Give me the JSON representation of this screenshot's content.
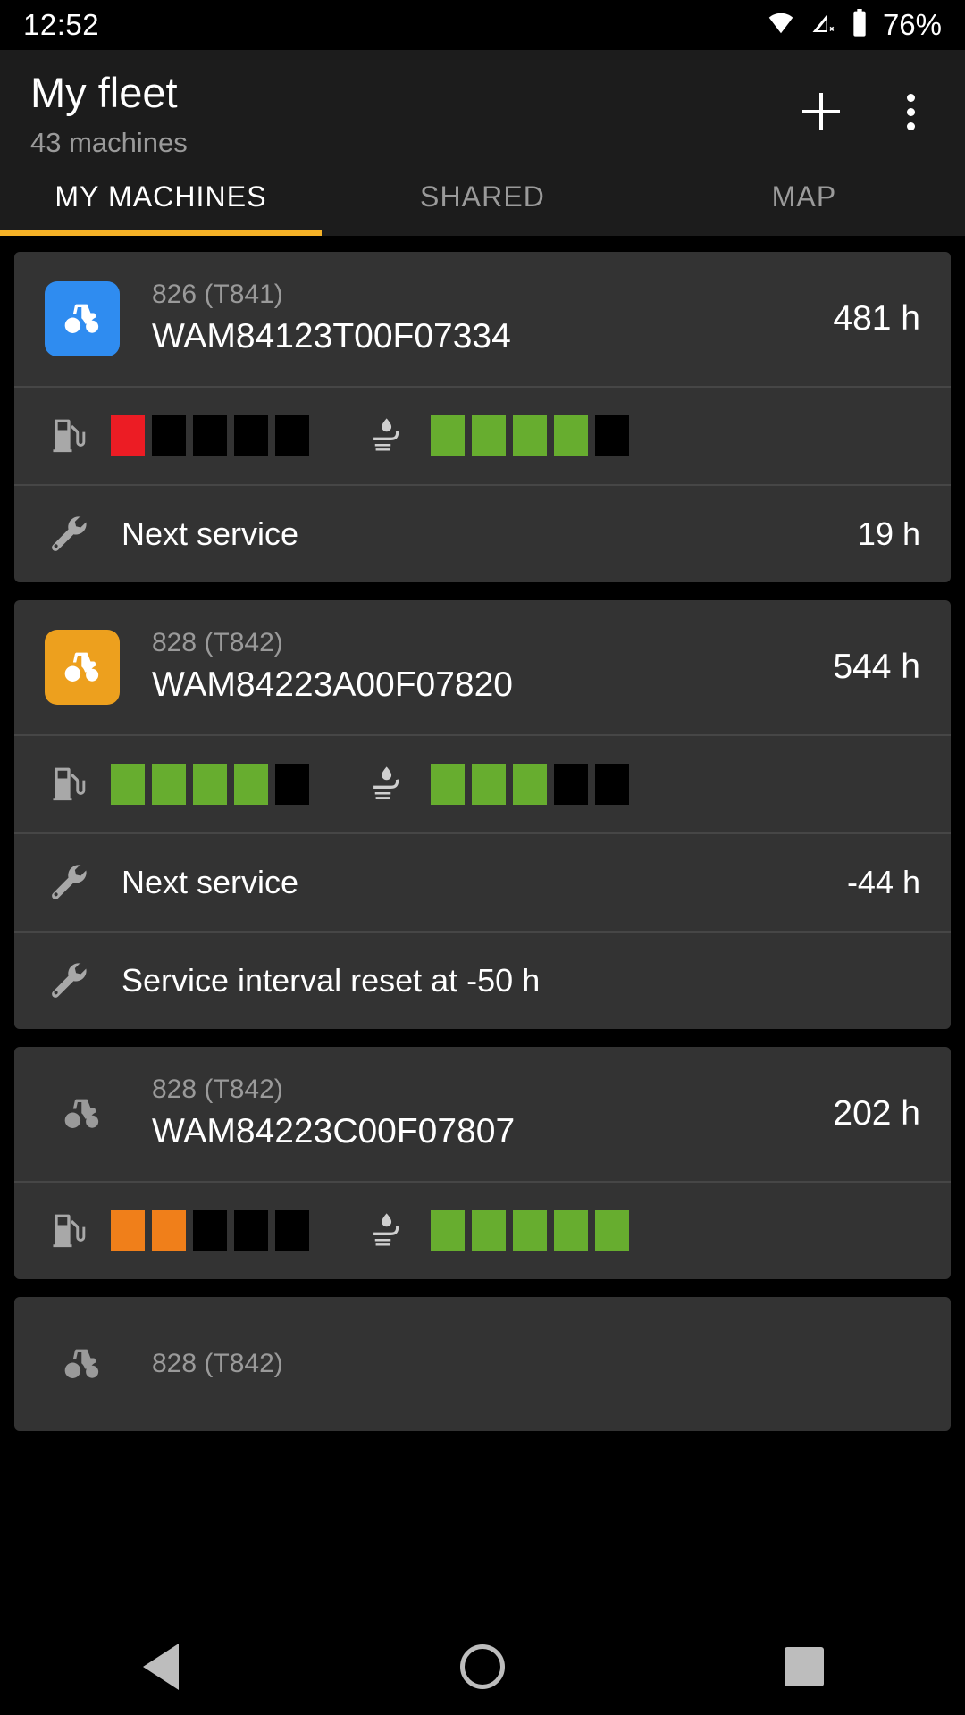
{
  "statusbar": {
    "time": "12:52",
    "battery_percent": "76%",
    "icons": [
      "wifi-icon",
      "cellular-off-icon",
      "battery-icon"
    ]
  },
  "appbar": {
    "title": "My fleet",
    "subtitle": "43 machines",
    "add_label": "+",
    "menu_label": "⋮"
  },
  "tabs": {
    "items": [
      {
        "label": "MY MACHINES",
        "active": true
      },
      {
        "label": "SHARED",
        "active": false
      },
      {
        "label": "MAP",
        "active": false
      }
    ],
    "indicator_color": "#f5b227"
  },
  "colors": {
    "accent": "#f5b227",
    "card_bg": "#333333",
    "page_bg": "#000000",
    "appbar_bg": "#1c1c1c",
    "bar_green": "#67ad2f",
    "bar_red": "#ec1c24",
    "bar_orange": "#f07f1a",
    "bar_empty": "#000000",
    "icon_blue": "#2f8cf0",
    "icon_orange": "#eda01e",
    "icon_grey": "#9a9a9a",
    "text_primary": "#ffffff",
    "text_secondary": "#9a9a9a"
  },
  "machines": [
    {
      "icon": "tractor-icon",
      "icon_color": "#2f8cf0",
      "icon_style": "filled",
      "model": "826 (T841)",
      "serial": "WAM84123T00F07334",
      "hours": "481 h",
      "fuel": {
        "icon": "fuel-pump-icon",
        "segments": [
          "red",
          "empty",
          "empty",
          "empty",
          "empty"
        ]
      },
      "def": {
        "icon": "def-fluid-icon",
        "segments": [
          "green",
          "green",
          "green",
          "green",
          "empty"
        ]
      },
      "rows": [
        {
          "icon": "wrench-icon",
          "label": "Next service",
          "value": "19 h"
        }
      ]
    },
    {
      "icon": "tractor-icon",
      "icon_color": "#eda01e",
      "icon_style": "filled",
      "model": "828 (T842)",
      "serial": "WAM84223A00F07820",
      "hours": "544 h",
      "fuel": {
        "icon": "fuel-pump-icon",
        "segments": [
          "green",
          "green",
          "green",
          "green",
          "empty"
        ]
      },
      "def": {
        "icon": "def-fluid-icon",
        "segments": [
          "green",
          "green",
          "green",
          "empty",
          "empty"
        ]
      },
      "rows": [
        {
          "icon": "wrench-icon",
          "label": "Next service",
          "value": "-44 h"
        },
        {
          "icon": "wrench-icon",
          "label": "Service interval reset at -50 h",
          "value": ""
        }
      ]
    },
    {
      "icon": "tractor-icon",
      "icon_color": "#9a9a9a",
      "icon_style": "plain",
      "model": "828 (T842)",
      "serial": "WAM84223C00F07807",
      "hours": "202 h",
      "fuel": {
        "icon": "fuel-pump-icon",
        "segments": [
          "orange",
          "orange",
          "empty",
          "empty",
          "empty"
        ]
      },
      "def": {
        "icon": "def-fluid-icon",
        "segments": [
          "green",
          "green",
          "green",
          "green",
          "green"
        ]
      },
      "rows": []
    },
    {
      "icon": "tractor-icon",
      "icon_color": "#9a9a9a",
      "icon_style": "plain",
      "model": "828 (T842)",
      "serial": "",
      "hours": "",
      "fuel": null,
      "def": null,
      "rows": []
    }
  ],
  "navbar": {
    "back_label": "back-button",
    "home_label": "home-button",
    "recents_label": "recents-button"
  }
}
